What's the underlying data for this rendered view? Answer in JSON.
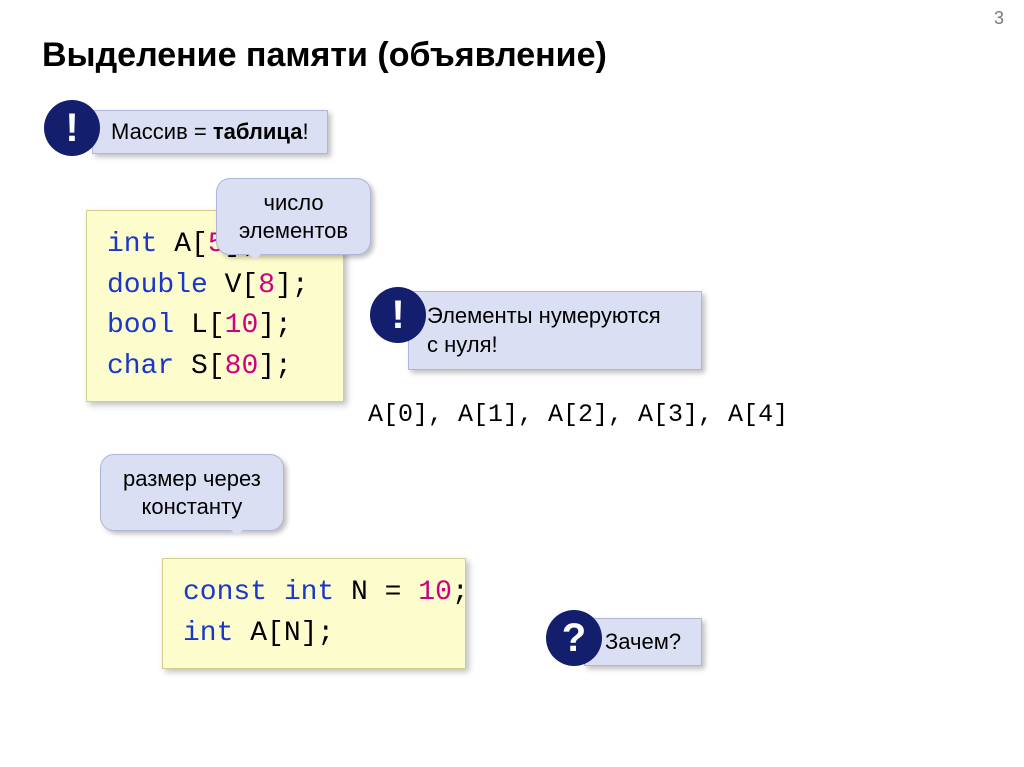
{
  "slide_number": "3",
  "title": "Выделение памяти (объявление)",
  "callouts": {
    "massiv_prefix": "Массив = ",
    "massiv_bold": "таблица",
    "massiv_bang": "!",
    "tag_line1": "число",
    "tag_line2": "элементов",
    "elem_line1": "Элементы нумеруются",
    "elem_line2": "с нуля!",
    "razmer_line1": "размер через",
    "razmer_line2": "константу",
    "zachem": "Зачем?"
  },
  "badges": {
    "bang1": "!",
    "bang2": "!",
    "question": "?"
  },
  "code1": {
    "l1_kw": "int",
    "l1_rest_a": " A[",
    "l1_num": "5",
    "l1_rest_b": "];",
    "l2_kw": "double",
    "l2_rest_a": " V[",
    "l2_num": "8",
    "l2_rest_b": "];",
    "l3_kw": "bool",
    "l3_rest_a": " L[",
    "l3_num": "10",
    "l3_rest_b": "];",
    "l4_kw": "char",
    "l4_rest_a": " S[",
    "l4_num": "80",
    "l4_rest_b": "];"
  },
  "code2": {
    "l1_kw1": "const",
    "l1_sp": " ",
    "l1_kw2": "int",
    "l1_rest_a": " N = ",
    "l1_num": "10",
    "l1_rest_b": ";",
    "l2_kw": "int",
    "l2_rest": " A[N];"
  },
  "indices": "A[0], A[1], A[2], A[3], A[4]"
}
